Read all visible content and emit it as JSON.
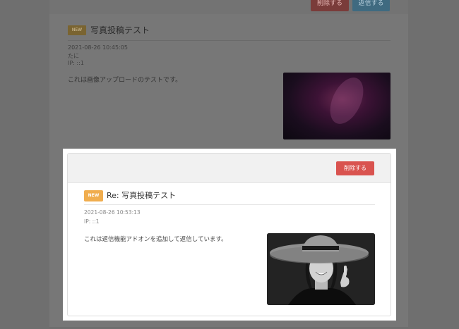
{
  "background": {
    "buttons": {
      "delete_label": "削除する",
      "reply_label": "返信する"
    },
    "post": {
      "badge": "NEW",
      "title": "写真投稿テスト",
      "timestamp": "2021-08-26 10:45:05",
      "author": "たに",
      "ip": "IP: ::1",
      "body": "これは画像アップロードのテストです。"
    }
  },
  "reply": {
    "delete_label": "削除する",
    "badge": "NEW",
    "title": "Re: 写真投稿テスト",
    "timestamp": "2021-08-26 10:53:13",
    "ip": "IP: ::1",
    "body": "これは返信機能アドオンを追加して返信しています。"
  },
  "colors": {
    "danger": "#d9534f",
    "badge": "#f0ad4e",
    "overlay": "#6f6f6f"
  },
  "icons": {
    "background_photo": "aurora-photo",
    "reply_photo": "woman-wide-brim-hat-photo"
  }
}
